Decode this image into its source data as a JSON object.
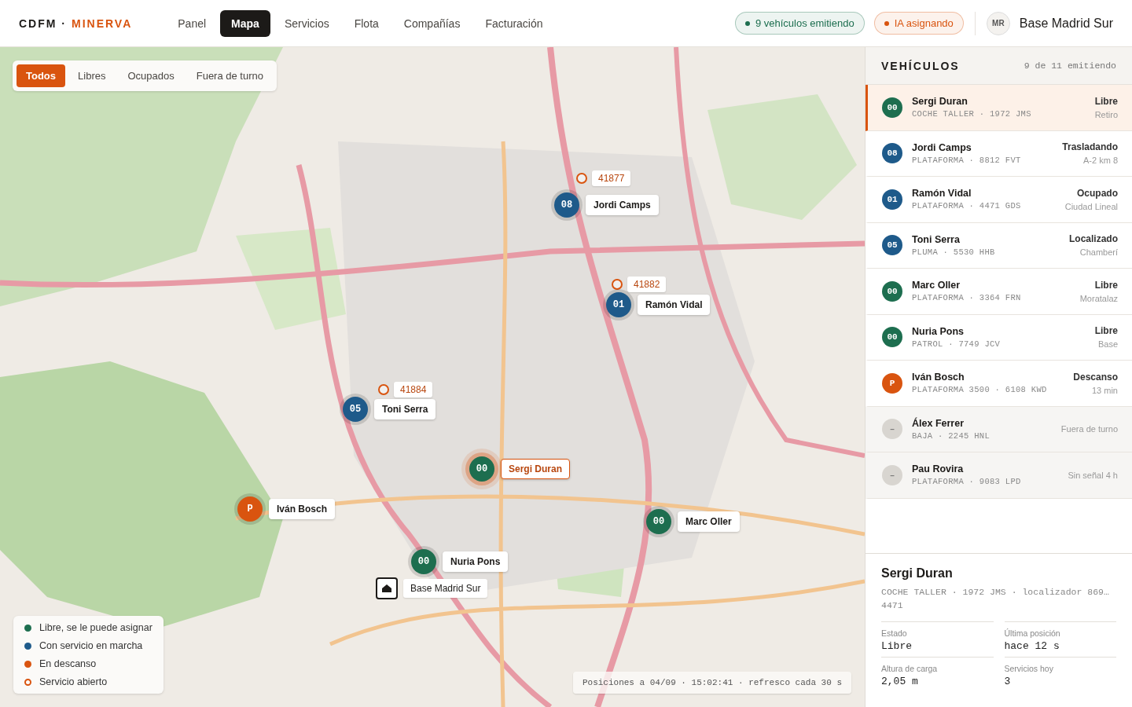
{
  "header": {
    "brand": {
      "primary": "CDFM ·",
      "accent": "MINERVA"
    },
    "nav": [
      {
        "label": "Panel",
        "selected": false
      },
      {
        "label": "Mapa",
        "selected": true
      },
      {
        "label": "Servicios",
        "selected": false
      },
      {
        "label": "Flota",
        "selected": false
      },
      {
        "label": "Compañías",
        "selected": false
      },
      {
        "label": "Facturación",
        "selected": false
      }
    ],
    "pills": [
      {
        "label": "9 vehículos emitiendo",
        "color": "#1d6e4f"
      },
      {
        "label": "IA asignando",
        "color": "#d9540f"
      }
    ],
    "user": {
      "initials": "MR",
      "name": "Base Madrid Sur"
    }
  },
  "map": {
    "filters": [
      {
        "label": "Todos",
        "selected": true
      },
      {
        "label": "Libres",
        "selected": false
      },
      {
        "label": "Ocupados",
        "selected": false
      },
      {
        "label": "Fuera de turno",
        "selected": false
      }
    ],
    "markers": [
      {
        "kind": "service",
        "label": "41877"
      },
      {
        "kind": "vehicle",
        "color": "#1e5a8a",
        "code": "08",
        "label": "Jordi Camps",
        "selected": false
      },
      {
        "kind": "service",
        "label": "41882"
      },
      {
        "kind": "vehicle",
        "color": "#1e5a8a",
        "code": "01",
        "label": "Ramón Vidal",
        "selected": false
      },
      {
        "kind": "service",
        "label": "41884"
      },
      {
        "kind": "vehicle",
        "color": "#1e5a8a",
        "code": "05",
        "label": "Toni Serra",
        "selected": false
      },
      {
        "kind": "vehicle",
        "color": "#1d6e4f",
        "code": "00",
        "label": "Sergi Duran",
        "selected": true
      },
      {
        "kind": "vehicle",
        "color": "#d9540f",
        "code": "P",
        "label": "Iván Bosch",
        "selected": false
      },
      {
        "kind": "vehicle",
        "color": "#1d6e4f",
        "code": "00",
        "label": "Marc Oller",
        "selected": false
      },
      {
        "kind": "vehicle",
        "color": "#1d6e4f",
        "code": "00",
        "label": "Nuria Pons",
        "selected": false
      },
      {
        "kind": "base",
        "label": "Base Madrid Sur"
      }
    ],
    "legend": [
      {
        "kind": "dot",
        "color": "#1d6e4f",
        "label": "Libre, se le puede asignar"
      },
      {
        "kind": "dot",
        "color": "#1e5a8a",
        "label": "Con servicio en marcha"
      },
      {
        "kind": "dot",
        "color": "#d9540f",
        "label": "En descanso"
      },
      {
        "kind": "ring",
        "color": "#d9540f",
        "label": "Servicio abierto"
      }
    ],
    "status_line": "Posiciones a 04/09 · 15:02:41 · refresco cada 30 s"
  },
  "panel": {
    "title": "VEHÍCULOS",
    "count": "9 de 11 emitiendo",
    "vehicles": [
      {
        "code": "00",
        "color": "#1d6e4f",
        "on_duty": true,
        "name": "Sergi Duran",
        "detail": "COCHE TALLER · 1972 JMS",
        "state": "Libre",
        "place": "Retiro",
        "selected": true
      },
      {
        "code": "08",
        "color": "#1e5a8a",
        "on_duty": true,
        "name": "Jordi Camps",
        "detail": "PLATAFORMA · 8812 FVT",
        "state": "Trasladando",
        "place": "A-2 km 8",
        "selected": false
      },
      {
        "code": "01",
        "color": "#1e5a8a",
        "on_duty": true,
        "name": "Ramón Vidal",
        "detail": "PLATAFORMA · 4471 GDS",
        "state": "Ocupado",
        "place": "Ciudad Lineal",
        "selected": false
      },
      {
        "code": "05",
        "color": "#1e5a8a",
        "on_duty": true,
        "name": "Toni Serra",
        "detail": "PLUMA · 5530 HHB",
        "state": "Localizado",
        "place": "Chamberí",
        "selected": false
      },
      {
        "code": "00",
        "color": "#1d6e4f",
        "on_duty": true,
        "name": "Marc Oller",
        "detail": "PLATAFORMA · 3364 FRN",
        "state": "Libre",
        "place": "Moratalaz",
        "selected": false
      },
      {
        "code": "00",
        "color": "#1d6e4f",
        "on_duty": true,
        "name": "Nuria Pons",
        "detail": "PATROL · 7749 JCV",
        "state": "Libre",
        "place": "Base",
        "selected": false
      },
      {
        "code": "P",
        "color": "#d9540f",
        "on_duty": true,
        "name": "Iván Bosch",
        "detail": "PLATAFORMA 3500 · 6108 KWD",
        "state": "Descanso",
        "place": "13 min",
        "selected": false
      },
      {
        "code": "–",
        "color": "#d8d5d0",
        "on_duty": false,
        "name": "Álex Ferrer",
        "detail": "BAJA · 2245 HNL",
        "state": "Fuera de turno",
        "selected": false
      },
      {
        "code": "–",
        "color": "#d8d5d0",
        "on_duty": false,
        "name": "Pau Rovira",
        "detail": "PLATAFORMA · 9083 LPD",
        "state": "Sin señal 4 h",
        "selected": false
      }
    ],
    "detail": {
      "name": "Sergi Duran",
      "meta": [
        "COCHE TALLER · 1972 JMS · localizador 869…",
        "4471"
      ],
      "fields": [
        {
          "label": "Estado",
          "value": "Libre"
        },
        {
          "label": "Última posición",
          "value": "hace 12 s"
        },
        {
          "label": "Altura de carga",
          "value": "2,05 m"
        },
        {
          "label": "Servicios hoy",
          "value": "3"
        }
      ]
    }
  }
}
